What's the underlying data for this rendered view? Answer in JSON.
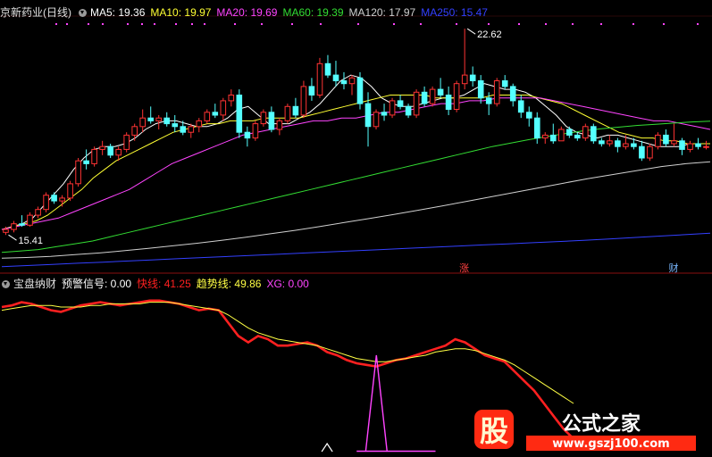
{
  "colors": {
    "up": "#ff3333",
    "down": "#54ffff",
    "ma5": "#ffffff",
    "ma10": "#ffff33",
    "ma20": "#ff44ff",
    "ma60": "#33dd33",
    "ma120": "#d0d0d0",
    "ma250": "#3340ff",
    "fast": "#ff2020",
    "trend": "#ffff44",
    "xg": "#ff44ff",
    "warn": "#ffffff"
  },
  "main_header": {
    "stock": "京新药业(日线)",
    "ma5": "MA5: 19.36",
    "ma10": "MA10: 19.97",
    "ma20": "MA20: 19.69",
    "ma60": "MA60: 19.39",
    "ma120": "MA120: 17.97",
    "ma250": "MA250: 15.47"
  },
  "sub_header": {
    "name": "宝盘纳财",
    "warn": "预警信号: 0.00",
    "fast": "快线: 41.25",
    "trend": "趋势线: 49.86",
    "xg": "XG: 0.00"
  },
  "markers": {
    "high": "22.62",
    "low": "15.41",
    "zhang": "涨",
    "cai": "财"
  },
  "watermark": {
    "logo": "股",
    "name": "公式之家",
    "url": "www.gszj100.com"
  },
  "chart_data": [
    {
      "type": "candlestick",
      "title": "京新药业(日线)",
      "ylim": [
        14.2,
        23.0
      ],
      "candles": [
        [
          15.5,
          15.7,
          15.41,
          15.6
        ],
        [
          15.6,
          15.9,
          15.5,
          15.8
        ],
        [
          15.8,
          16.1,
          15.7,
          15.75
        ],
        [
          15.75,
          16.2,
          15.7,
          16.1
        ],
        [
          16.1,
          16.4,
          16.0,
          16.3
        ],
        [
          16.3,
          16.9,
          16.2,
          16.8
        ],
        [
          16.8,
          16.9,
          16.5,
          16.6
        ],
        [
          16.6,
          16.8,
          16.4,
          16.7
        ],
        [
          16.7,
          17.3,
          16.6,
          17.2
        ],
        [
          17.2,
          18.1,
          17.1,
          18.0
        ],
        [
          18.0,
          18.4,
          17.7,
          17.9
        ],
        [
          17.9,
          18.5,
          17.8,
          18.4
        ],
        [
          18.4,
          18.7,
          18.2,
          18.5
        ],
        [
          18.5,
          18.6,
          18.1,
          18.2
        ],
        [
          18.2,
          18.5,
          18.0,
          18.4
        ],
        [
          18.4,
          19.0,
          18.3,
          18.9
        ],
        [
          18.9,
          19.3,
          18.7,
          19.2
        ],
        [
          19.2,
          19.8,
          19.0,
          19.5
        ],
        [
          19.5,
          19.9,
          19.3,
          19.4
        ],
        [
          19.4,
          19.6,
          19.1,
          19.5
        ],
        [
          19.5,
          19.7,
          19.2,
          19.3
        ],
        [
          19.3,
          19.6,
          19.0,
          19.2
        ],
        [
          19.2,
          19.4,
          18.9,
          19.0
        ],
        [
          19.0,
          19.3,
          18.8,
          19.2
        ],
        [
          19.2,
          19.5,
          19.0,
          19.4
        ],
        [
          19.4,
          19.8,
          19.3,
          19.7
        ],
        [
          19.7,
          20.0,
          19.5,
          19.6
        ],
        [
          19.6,
          20.2,
          19.4,
          20.1
        ],
        [
          20.1,
          20.5,
          19.9,
          20.3
        ],
        [
          20.3,
          20.5,
          18.8,
          19.0
        ],
        [
          19.0,
          19.2,
          18.5,
          18.8
        ],
        [
          18.8,
          19.4,
          18.7,
          19.3
        ],
        [
          19.3,
          19.8,
          19.2,
          19.7
        ],
        [
          19.7,
          19.9,
          19.0,
          19.1
        ],
        [
          19.1,
          19.5,
          18.9,
          19.4
        ],
        [
          19.4,
          20.0,
          19.3,
          19.9
        ],
        [
          19.9,
          20.2,
          19.5,
          19.6
        ],
        [
          19.6,
          20.8,
          19.5,
          20.6
        ],
        [
          20.6,
          20.9,
          20.1,
          20.3
        ],
        [
          20.3,
          21.6,
          20.2,
          21.4
        ],
        [
          21.4,
          21.7,
          20.9,
          21.0
        ],
        [
          21.0,
          21.5,
          20.6,
          20.8
        ],
        [
          20.8,
          21.1,
          20.5,
          20.7
        ],
        [
          20.7,
          21.0,
          20.3,
          20.9
        ],
        [
          20.9,
          21.1,
          19.8,
          20.0
        ],
        [
          20.0,
          20.4,
          18.5,
          19.2
        ],
        [
          19.2,
          19.8,
          19.1,
          19.7
        ],
        [
          19.7,
          20.0,
          19.4,
          19.6
        ],
        [
          19.6,
          20.2,
          19.5,
          20.1
        ],
        [
          20.1,
          20.3,
          19.8,
          19.9
        ],
        [
          19.9,
          20.0,
          19.5,
          19.6
        ],
        [
          19.6,
          20.5,
          19.5,
          20.4
        ],
        [
          20.4,
          20.6,
          19.9,
          20.0
        ],
        [
          20.0,
          20.6,
          19.9,
          20.5
        ],
        [
          20.5,
          20.9,
          20.2,
          20.3
        ],
        [
          20.3,
          20.6,
          19.6,
          19.8
        ],
        [
          19.8,
          20.8,
          19.7,
          20.7
        ],
        [
          20.7,
          22.62,
          20.5,
          21.0
        ],
        [
          21.0,
          21.3,
          20.6,
          20.8
        ],
        [
          20.8,
          21.0,
          20.0,
          20.2
        ],
        [
          20.2,
          20.4,
          19.6,
          20.0
        ],
        [
          20.0,
          20.9,
          19.9,
          20.8
        ],
        [
          20.8,
          21.0,
          20.5,
          20.6
        ],
        [
          20.6,
          20.7,
          19.9,
          20.1
        ],
        [
          20.1,
          20.3,
          19.5,
          19.7
        ],
        [
          19.7,
          19.9,
          19.2,
          19.5
        ],
        [
          19.5,
          19.7,
          18.6,
          18.8
        ],
        [
          18.8,
          19.0,
          18.6,
          18.9
        ],
        [
          18.9,
          19.3,
          18.6,
          18.7
        ],
        [
          18.7,
          19.2,
          18.7,
          19.1
        ],
        [
          19.1,
          19.2,
          18.8,
          18.9
        ],
        [
          18.9,
          19.0,
          18.7,
          18.8
        ],
        [
          18.8,
          19.3,
          18.7,
          19.2
        ],
        [
          19.2,
          19.3,
          18.6,
          18.7
        ],
        [
          18.7,
          18.8,
          18.5,
          18.6
        ],
        [
          18.6,
          18.9,
          18.5,
          18.7
        ],
        [
          18.7,
          18.8,
          18.3,
          18.5
        ],
        [
          18.5,
          18.9,
          18.4,
          18.6
        ],
        [
          18.6,
          18.8,
          18.4,
          18.5
        ],
        [
          18.5,
          18.7,
          18.0,
          18.1
        ],
        [
          18.1,
          18.6,
          18.0,
          18.5
        ],
        [
          18.5,
          19.0,
          18.4,
          18.9
        ],
        [
          18.9,
          19.1,
          18.5,
          18.6
        ],
        [
          18.6,
          19.3,
          18.5,
          18.7
        ],
        [
          18.7,
          18.8,
          18.2,
          18.4
        ],
        [
          18.4,
          18.7,
          18.3,
          18.6
        ],
        [
          18.6,
          18.8,
          18.4,
          18.5
        ],
        [
          18.5,
          18.7,
          18.4,
          18.5
        ]
      ],
      "ma": {
        "MA5": [
          15.6,
          15.7,
          15.8,
          16.0,
          16.4,
          16.8,
          17.2,
          17.7,
          18.1,
          18.4,
          18.5,
          18.5,
          18.6,
          18.8,
          19.1,
          19.3,
          19.4,
          19.4,
          19.3,
          19.2,
          19.2,
          19.3,
          19.5,
          19.8,
          19.9,
          19.6,
          19.3,
          19.3,
          19.3,
          19.5,
          19.7,
          20.0,
          20.4,
          20.8,
          21.0,
          20.9,
          20.6,
          20.2,
          20.0,
          19.9,
          19.9,
          20.0,
          20.1,
          20.2,
          20.2,
          20.3,
          20.5,
          20.7,
          20.6,
          20.5,
          20.5,
          20.4,
          20.2,
          19.9,
          19.6,
          19.2,
          19.0,
          18.9,
          18.8,
          18.9,
          18.9,
          18.8,
          18.7,
          18.6,
          18.5,
          18.5,
          18.5,
          18.6,
          18.6,
          18.6
        ],
        "MA10": [
          15.6,
          15.7,
          15.8,
          15.9,
          16.1,
          16.4,
          16.7,
          17.0,
          17.4,
          17.7,
          18.0,
          18.2,
          18.4,
          18.6,
          18.8,
          19.0,
          19.1,
          19.2,
          19.3,
          19.3,
          19.4,
          19.4,
          19.4,
          19.5,
          19.5,
          19.5,
          19.5,
          19.6,
          19.7,
          19.8,
          19.9,
          20.0,
          20.1,
          20.2,
          20.3,
          20.3,
          20.3,
          20.3,
          20.2,
          20.2,
          20.2,
          20.2,
          20.2,
          20.3,
          20.3,
          20.3,
          20.3,
          20.2,
          20.1,
          20.0,
          19.8,
          19.6,
          19.4,
          19.2,
          19.0,
          18.9,
          18.8,
          18.8,
          18.7,
          18.7,
          18.6,
          18.6,
          18.6
        ],
        "MA20": [
          15.6,
          15.7,
          15.8,
          15.9,
          16.0,
          16.2,
          16.4,
          16.6,
          16.8,
          17.0,
          17.3,
          17.6,
          17.9,
          18.1,
          18.3,
          18.5,
          18.7,
          18.9,
          19.0,
          19.1,
          19.2,
          19.3,
          19.4,
          19.4,
          19.5,
          19.5,
          19.6,
          19.7,
          19.7,
          19.8,
          19.9,
          20.0,
          20.0,
          20.1,
          20.1,
          20.2,
          20.2,
          20.2,
          20.2,
          20.1,
          20.0,
          19.9,
          19.8,
          19.7,
          19.6,
          19.5,
          19.4,
          19.4,
          19.3,
          19.2,
          19.1
        ],
        "MA60": [
          14.8,
          14.85,
          14.9,
          15.0,
          15.1,
          15.2,
          15.35,
          15.5,
          15.65,
          15.8,
          15.95,
          16.1,
          16.25,
          16.4,
          16.55,
          16.7,
          16.85,
          17.0,
          17.15,
          17.3,
          17.45,
          17.6,
          17.75,
          17.9,
          18.05,
          18.2,
          18.35,
          18.5,
          18.62,
          18.74,
          18.85,
          18.95,
          19.05,
          19.12,
          19.18,
          19.24,
          19.28,
          19.32,
          19.36,
          19.39
        ],
        "MA120": [
          14.6,
          14.62,
          14.66,
          14.72,
          14.78,
          14.86,
          14.94,
          15.03,
          15.12,
          15.22,
          15.33,
          15.45,
          15.57,
          15.7,
          15.84,
          15.98,
          16.12,
          16.27,
          16.42,
          16.58,
          16.74,
          16.9,
          17.06,
          17.22,
          17.38,
          17.52,
          17.66,
          17.8,
          17.9,
          17.97
        ],
        "MA250": [
          14.3,
          14.34,
          14.38,
          14.42,
          14.46,
          14.5,
          14.54,
          14.58,
          14.62,
          14.66,
          14.7,
          14.74,
          14.78,
          14.82,
          14.86,
          14.9,
          14.94,
          14.98,
          15.02,
          15.06,
          15.1,
          15.14,
          15.18,
          15.22,
          15.27,
          15.32,
          15.37,
          15.42,
          15.47
        ]
      },
      "annotations": [
        {
          "text": "22.62",
          "x_index": 57,
          "y": 22.62
        },
        {
          "text": "15.41",
          "x_index": 0,
          "y": 15.41
        },
        {
          "text": "涨",
          "x_index": 57
        },
        {
          "text": "财",
          "x_index": 83
        }
      ]
    },
    {
      "type": "line",
      "title": "宝盘纳财",
      "ylim": [
        0,
        100
      ],
      "series": [
        {
          "name": "快线",
          "color": "#ff2020",
          "values": [
            90,
            91,
            93,
            92,
            90,
            88,
            87,
            89,
            91,
            92,
            93,
            92,
            91,
            92,
            93,
            94,
            94,
            93,
            92,
            90,
            88,
            89,
            88,
            80,
            72,
            68,
            72,
            70,
            66,
            66,
            67,
            68,
            66,
            62,
            60,
            57,
            55,
            54,
            53,
            55,
            57,
            58,
            60,
            62,
            64,
            66,
            70,
            68,
            64,
            60,
            58,
            56,
            50,
            44,
            38,
            30,
            22,
            14,
            8
          ]
        },
        {
          "name": "趋势线",
          "color": "#ffff44",
          "values": [
            88,
            89,
            90,
            91,
            91,
            91,
            90,
            90,
            90,
            91,
            91,
            92,
            92,
            92,
            92,
            93,
            93,
            93,
            92,
            91,
            90,
            89,
            88,
            85,
            81,
            77,
            74,
            72,
            70,
            69,
            68,
            67,
            66,
            64,
            62,
            60,
            58,
            57,
            56,
            56,
            57,
            58,
            59,
            60,
            62,
            63,
            64,
            64,
            63,
            61,
            59,
            57,
            54,
            50,
            46,
            42,
            38,
            34,
            30
          ]
        },
        {
          "name": "XG",
          "color": "#ff44ff",
          "values": [
            0,
            0,
            0,
            0,
            0,
            0,
            0,
            0,
            0,
            0,
            0,
            0,
            0,
            0,
            0,
            0,
            0,
            0,
            0,
            0,
            0,
            0,
            0,
            0,
            0,
            0,
            0,
            0,
            0,
            0,
            0,
            0,
            0,
            0,
            0,
            0,
            0,
            0,
            0,
            0,
            0,
            0,
            0,
            0,
            0,
            0,
            0,
            0,
            0,
            0,
            0,
            0,
            0,
            0,
            0,
            0,
            0,
            0,
            0
          ]
        }
      ],
      "xg_spike_index": 38,
      "warn_bump_index": 33
    }
  ]
}
